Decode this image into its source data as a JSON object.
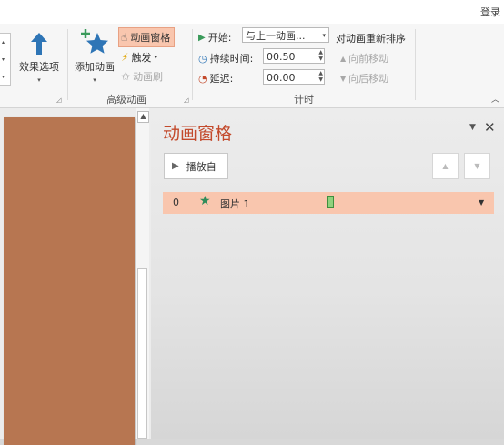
{
  "top_bar": {
    "login": "登录"
  },
  "ribbon": {
    "effect_options": {
      "label": "效果选项"
    },
    "add_animation": {
      "label": "添加动画"
    },
    "animation_pane": {
      "label": "动画窗格"
    },
    "trigger": {
      "label": "触发"
    },
    "animation_painter": {
      "label": "动画刷"
    },
    "advanced_group_label": "高级动画",
    "start": {
      "label": "开始:",
      "value": "与上一动画..."
    },
    "duration": {
      "label": "持续时间:",
      "value": "00.50"
    },
    "delay": {
      "label": "延迟:",
      "value": "00.00"
    },
    "timing_group_label": "计时",
    "reorder": {
      "title": "对动画重新排序",
      "move_earlier": "向前移动",
      "move_later": "向后移动"
    }
  },
  "animation_pane": {
    "title": "动画窗格",
    "play_button": "播放自",
    "items": [
      {
        "index": "0",
        "name": "图片 1"
      }
    ]
  },
  "colors": {
    "accent_title": "#c34a2c",
    "selected_row": "#f9c6ae",
    "slide_thumbnail": "#b77651",
    "entrance_star": "#2e8c5a",
    "timing_bar": "#8fd17d"
  }
}
